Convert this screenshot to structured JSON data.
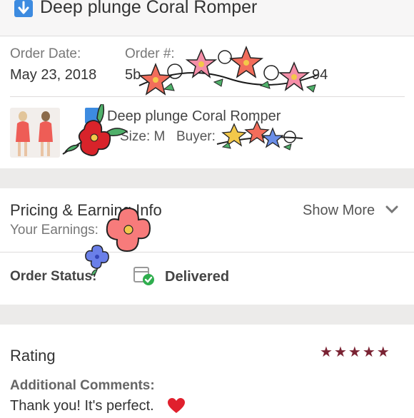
{
  "header": {
    "title": "Deep plunge Coral Romper"
  },
  "order": {
    "date_label": "Order Date:",
    "date_value": "May 23, 2018",
    "number_label": "Order #:",
    "number_prefix": "5b",
    "number_suffix": "94"
  },
  "item": {
    "title": "Deep plunge Coral Romper",
    "size_label": "Size: M",
    "buyer_label": "Buyer:"
  },
  "pricing": {
    "title": "Pricing & Earning Info",
    "earnings_label": "Your Earnings:",
    "show_more": "Show More"
  },
  "status": {
    "label": "Order Status:",
    "value": "Delivered"
  },
  "rating": {
    "title": "Rating",
    "stars": 5,
    "comments_label": "Additional Comments:",
    "comments_text": "Thank you! It's perfect."
  },
  "colors": {
    "star": "#7a2333",
    "delivered_check": "#2fae4e",
    "arrow_badge": "#3d8be0",
    "heart": "#e0202d"
  }
}
